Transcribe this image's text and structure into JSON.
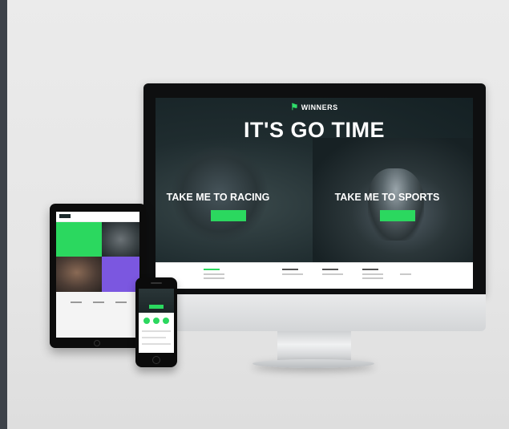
{
  "desktop": {
    "brand": "WINNERS",
    "headline": "IT'S GO TIME",
    "racing_cta": "TAKE ME TO RACING",
    "sports_cta": "TAKE ME TO SPORTS"
  },
  "colors": {
    "accent": "#2bd85f",
    "hero_dark": "#1b2b2e",
    "purple": "#7b57e0"
  },
  "icons": [
    "flag-icon"
  ]
}
